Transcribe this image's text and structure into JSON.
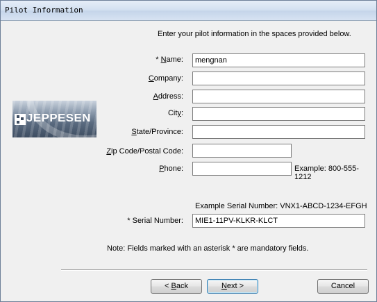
{
  "window": {
    "title": "Pilot Information"
  },
  "intro_text": "Enter your pilot information in the spaces provided below.",
  "logo": {
    "text": "JEPPESEN"
  },
  "fields": {
    "name": {
      "label_prefix": "* ",
      "label_key": "N",
      "label_rest": "ame:",
      "value": "mengnan"
    },
    "company": {
      "label_key": "C",
      "label_rest": "ompany:",
      "value": ""
    },
    "address": {
      "label_key": "A",
      "label_rest": "ddress:",
      "value": ""
    },
    "city": {
      "label_pre": "Cit",
      "label_key": "y",
      "label_rest": ":",
      "value": ""
    },
    "state": {
      "label_key": "S",
      "label_rest": "tate/Province:",
      "value": ""
    },
    "zip": {
      "label_key": "Z",
      "label_rest": "ip Code/Postal Code:",
      "value": ""
    },
    "phone": {
      "label_key": "P",
      "label_rest": "hone:",
      "value": "",
      "example": "Example: 800-555-1212"
    },
    "serial": {
      "label": "* Serial Number:",
      "value": "MIE1-11PV-KLKR-KLCT",
      "example": "Example Serial Number: VNX1-ABCD-1234-EFGH"
    }
  },
  "note": "Note:  Fields marked with an asterisk * are mandatory fields.",
  "buttons": {
    "back": {
      "prefix": "< ",
      "key": "B",
      "rest": "ack"
    },
    "next": {
      "key": "N",
      "rest": "ext >"
    },
    "cancel": {
      "label": "Cancel"
    }
  },
  "colors": {
    "title_bar": "#d4e1f1",
    "field_border": "#7a7a7a",
    "default_button_border": "#3c7fb1"
  }
}
